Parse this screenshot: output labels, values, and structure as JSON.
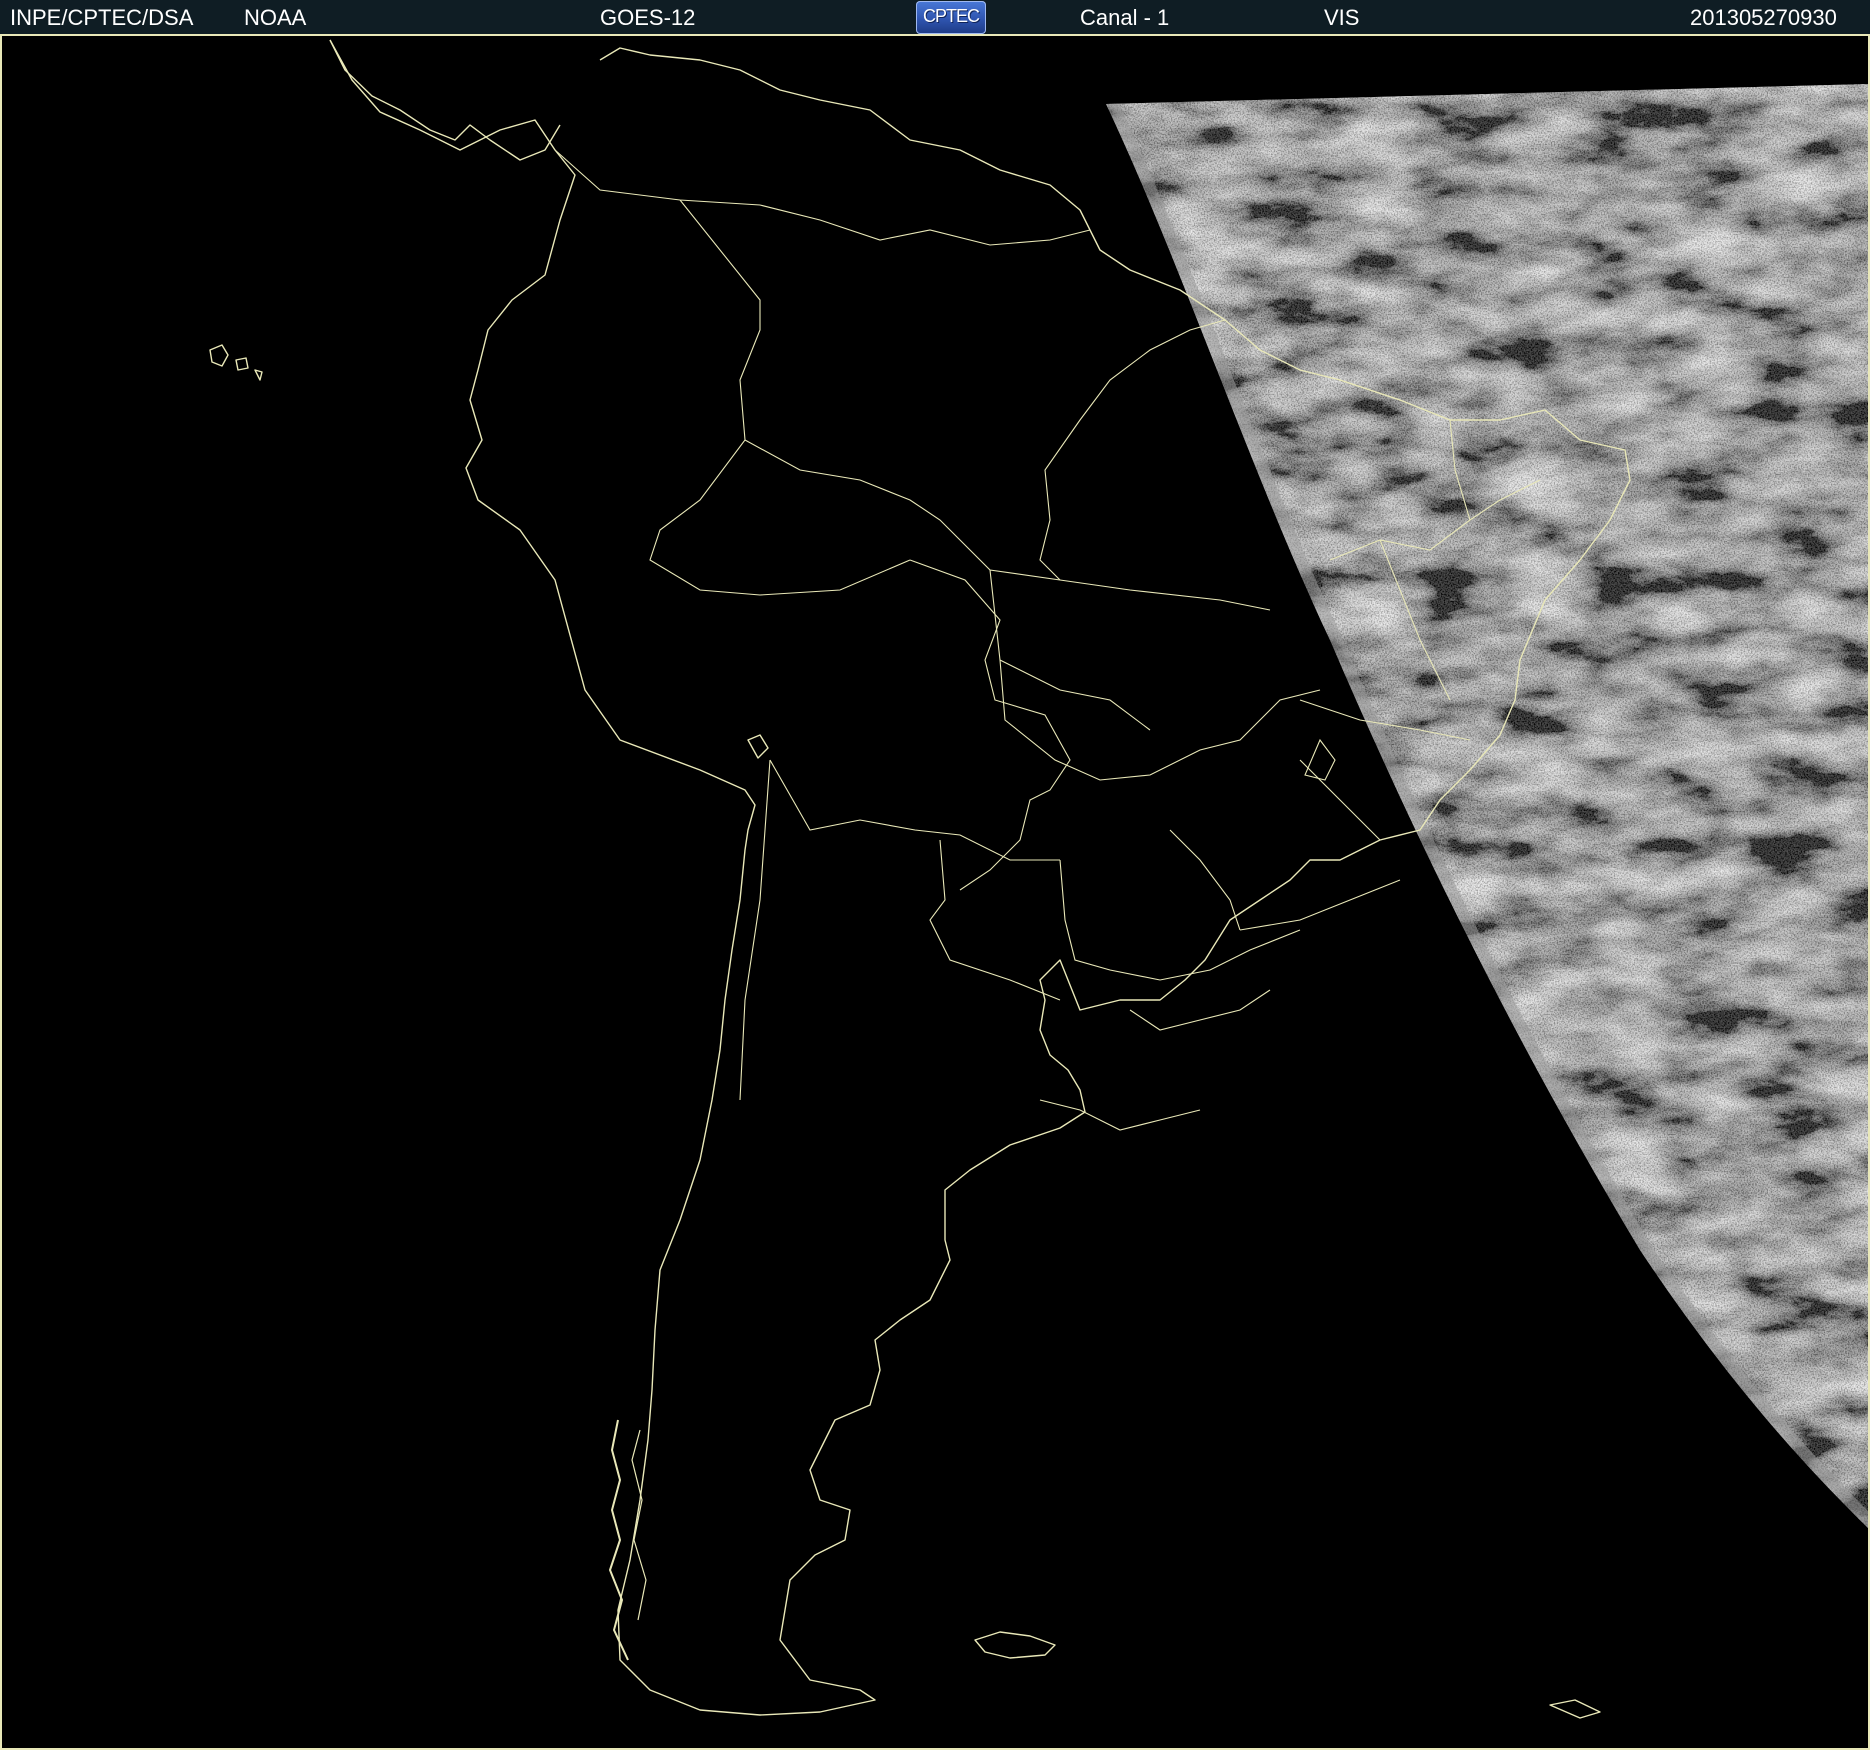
{
  "header": {
    "agency": "INPE/CPTEC/DSA",
    "source": "NOAA",
    "satellite": "GOES-12",
    "logo_text": "CPTEC",
    "channel": "Canal - 1",
    "band": "VIS",
    "timestamp": "201305270930"
  },
  "colors": {
    "background": "#000000",
    "coastline": "#e9e8b8",
    "header_bg": "#0f1d24",
    "header_text": "#ffffff",
    "cloud_gray": "#6b6b6b"
  },
  "map": {
    "type": "satellite-visible-image",
    "region": "South America",
    "illuminated_area": "east"
  }
}
